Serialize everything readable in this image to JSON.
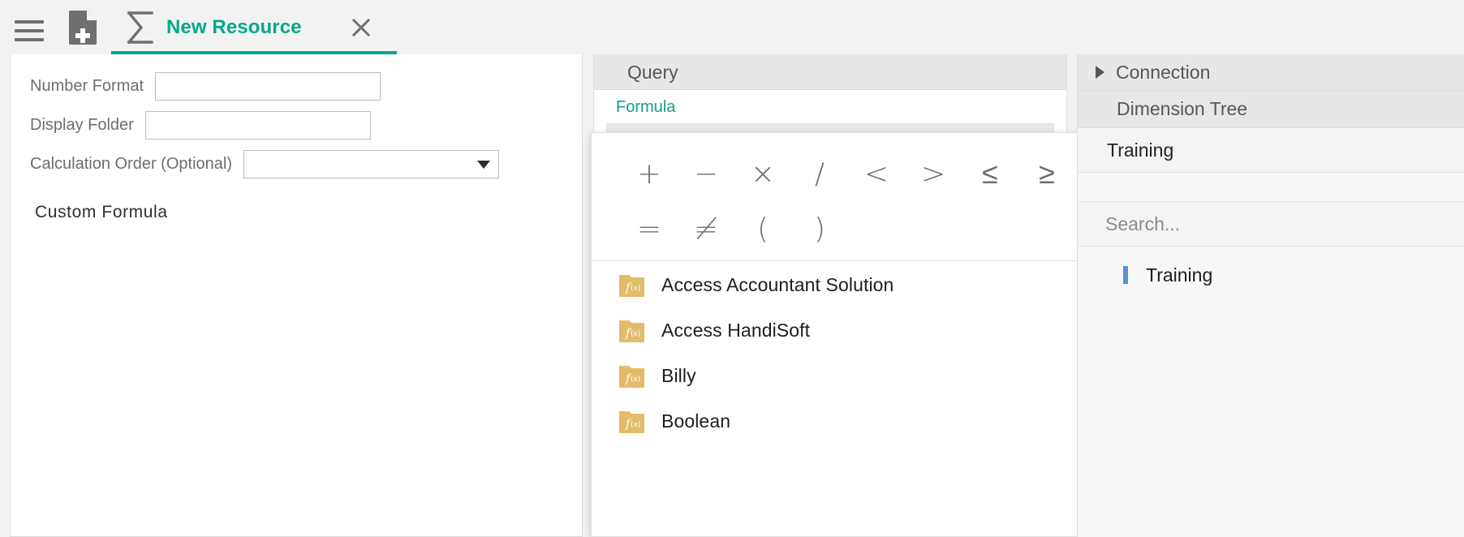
{
  "toolbar": {
    "menu_icon": "hamburger-menu-icon",
    "new_doc_icon": "new-document-icon",
    "sigma_icon": "sigma-icon",
    "tab_label": "New Resource",
    "close_icon": "close-icon",
    "accent_color": "#00A88F"
  },
  "form": {
    "rows": [
      {
        "label": "Number Format",
        "value": "",
        "placeholder": ""
      },
      {
        "label": "Display Folder",
        "value": "",
        "placeholder": ""
      },
      {
        "label": "Calculation Order (Optional)",
        "value": "",
        "placeholder": ""
      }
    ],
    "custom_formula_heading": "Custom Formula"
  },
  "query_panel": {
    "header_title": "Query",
    "formula_label": "Formula",
    "formula_value": ""
  },
  "function_popup": {
    "operators_row1": [
      "+",
      "−",
      "×",
      "/",
      "<",
      ">",
      "≤",
      "≥"
    ],
    "operators_row2": [
      "=",
      "≠",
      "(",
      ")"
    ],
    "items": [
      {
        "label": "Access Accountant Solution",
        "icon": "function-folder-icon",
        "chevron": "chevron-right-icon"
      },
      {
        "label": "Access HandiSoft",
        "icon": "function-folder-icon",
        "chevron": "chevron-right-icon"
      },
      {
        "label": "Billy",
        "icon": "function-folder-icon",
        "chevron": "chevron-right-icon"
      },
      {
        "label": "Boolean",
        "icon": "function-folder-icon",
        "chevron": "chevron-right-icon"
      }
    ],
    "icon_color": "#E3BC6A"
  },
  "right_panel": {
    "connection_label": "Connection",
    "connection_caret": "triangle-right-icon",
    "dimension_tree_title": "Dimension Tree",
    "selected_dimension": "Training",
    "search_placeholder": "Search...",
    "tree_item": "Training"
  }
}
